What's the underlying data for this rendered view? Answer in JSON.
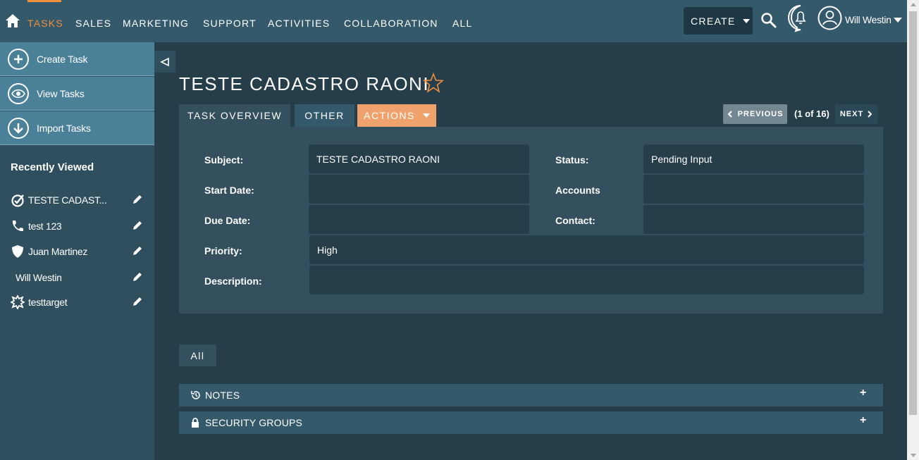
{
  "nav": {
    "items": [
      "Tasks",
      "Sales",
      "Marketing",
      "Support",
      "Activities",
      "Collaboration",
      "All"
    ],
    "create_label": "CREATE",
    "user_name": "Will Westin"
  },
  "sidebar": {
    "actions": [
      "Create Task",
      "View Tasks",
      "Import Tasks"
    ],
    "recent_title": "Recently Viewed",
    "recent": [
      "TESTE CADAST...",
      "test 123",
      "Juan Martinez",
      "Will Westin",
      "testtarget"
    ]
  },
  "record": {
    "title": "TESTE CADASTRO RAONI",
    "tabs": [
      "TASK OVERVIEW",
      "OTHER",
      "ACTIONS"
    ],
    "prev_label": "PREVIOUS",
    "next_label": "NEXT",
    "counter": "(1 of 16)"
  },
  "fields": {
    "subject_label": "Subject:",
    "subject_value": "TESTE CADASTRO RAONI",
    "status_label": "Status:",
    "status_value": "Pending Input",
    "start_label": "Start Date:",
    "start_value": "",
    "accounts_label": "Accounts",
    "accounts_value": "",
    "due_label": "Due Date:",
    "due_value": "",
    "contact_label": "Contact:",
    "contact_value": "",
    "priority_label": "Priority:",
    "priority_value": "High",
    "description_label": "Description:",
    "description_value": ""
  },
  "subpanels": {
    "filter_label": "All",
    "notes_label": "NOTES",
    "security_label": "SECURITY GROUPS",
    "plus": "+"
  },
  "colors": {
    "accent": "#f08f3c",
    "header": "#34596b",
    "background": "#263d4a",
    "actions_tab": "#f0a26c"
  }
}
